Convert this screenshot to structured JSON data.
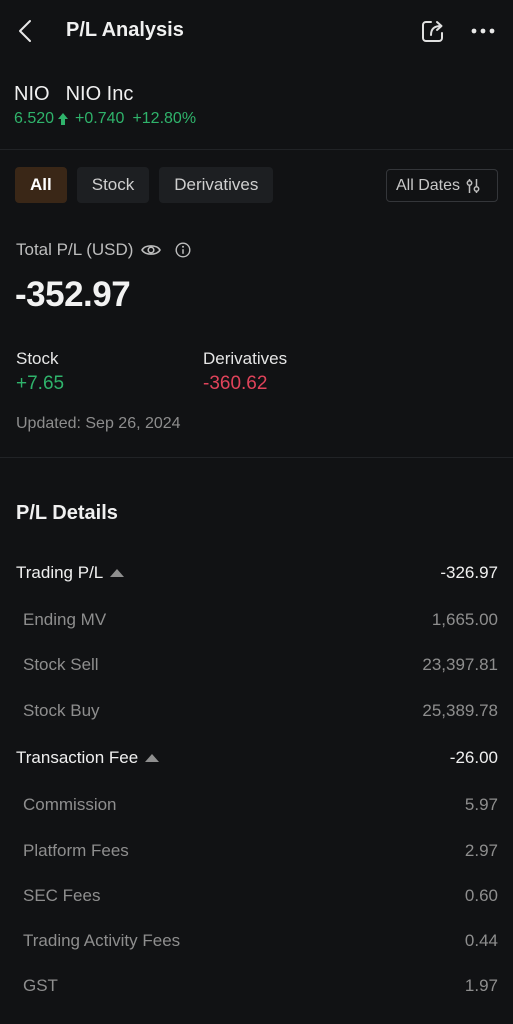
{
  "header": {
    "title": "P/L Analysis",
    "back_icon": "chevron-left-icon",
    "share_icon": "share-icon",
    "more_icon": "more-horizontal-icon"
  },
  "stock": {
    "symbol": "NIO",
    "name": "NIO Inc",
    "price": "6.520",
    "direction_icon": "arrow-up-icon",
    "change": "+0.740",
    "change_pct": "+12.80%"
  },
  "filters": {
    "tabs": [
      {
        "label": "All",
        "active": true
      },
      {
        "label": "Stock",
        "active": false
      },
      {
        "label": "Derivatives",
        "active": false
      }
    ],
    "date_filter": "All Dates",
    "date_filter_icon": "sliders-icon"
  },
  "summary": {
    "total_label": "Total P/L (USD)",
    "total_value": "-352.97",
    "stock_label": "Stock",
    "stock_value": "+7.65",
    "derivatives_label": "Derivatives",
    "derivatives_value": "-360.62",
    "updated": "Updated: Sep 26, 2024"
  },
  "details": {
    "title": "P/L Details",
    "trading": {
      "label": "Trading P/L",
      "value": "-326.97",
      "items": [
        {
          "label": "Ending MV",
          "value": "1,665.00"
        },
        {
          "label": "Stock Sell",
          "value": "23,397.81"
        },
        {
          "label": "Stock Buy",
          "value": "25,389.78"
        }
      ]
    },
    "fees": {
      "label": "Transaction Fee",
      "value": "-26.00",
      "items": [
        {
          "label": "Commission",
          "value": "5.97"
        },
        {
          "label": "Platform Fees",
          "value": "2.97"
        },
        {
          "label": "SEC Fees",
          "value": "0.60"
        },
        {
          "label": "Trading Activity Fees",
          "value": "0.44"
        },
        {
          "label": "GST",
          "value": "1.97"
        }
      ]
    }
  },
  "colors": {
    "background": "#111214",
    "positive": "#2fb36b",
    "negative": "#e0435a",
    "active_tab": "#3a2717"
  }
}
